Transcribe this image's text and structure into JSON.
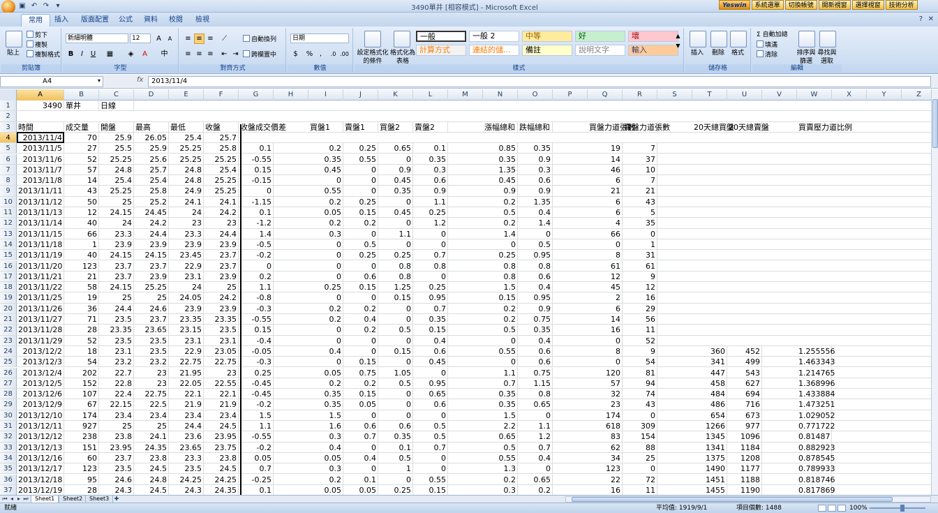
{
  "window": {
    "title": "3490單井 [相容模式] - Microsoft Excel",
    "addins": [
      "Yeswin",
      "系統選單",
      "切換帳號",
      "開新視窗",
      "選擇視窗",
      "技術分析"
    ]
  },
  "tabs": [
    "常用",
    "插入",
    "版面配置",
    "公式",
    "資料",
    "校閱",
    "檢視"
  ],
  "ribbon": {
    "clipboard": {
      "label": "剪貼簿",
      "paste": "貼上",
      "cut": "剪下",
      "copy": "複製",
      "format_painter": "複製格式"
    },
    "font": {
      "label": "字型",
      "font_name": "新細明體",
      "font_size": "12",
      "bold": "B",
      "italic": "I",
      "underline": "U"
    },
    "alignment": {
      "label": "對齊方式",
      "wrap": "自動換列",
      "merge": "跨欄置中"
    },
    "number": {
      "label": "數值",
      "format": "日期",
      "currency": "$",
      "percent": "%",
      "comma": ","
    },
    "styles": {
      "label": "樣式",
      "cond_format": "設定格式化的條件",
      "table_format": "格式化為表格",
      "items": [
        {
          "text": "一般",
          "bg": "#ffffff",
          "fg": "#000000"
        },
        {
          "text": "一般 2",
          "bg": "#ffffff",
          "fg": "#000000"
        },
        {
          "text": "中等",
          "bg": "#ffeb9c",
          "fg": "#9c6500"
        },
        {
          "text": "好",
          "bg": "#c6efce",
          "fg": "#006100"
        },
        {
          "text": "壞",
          "bg": "#ffc7ce",
          "fg": "#9c0006"
        },
        {
          "text": "計算方式",
          "bg": "#f2f2f2",
          "fg": "#fa7d00"
        },
        {
          "text": "連結的儲...",
          "bg": "#ffffff",
          "fg": "#fa7d00"
        },
        {
          "text": "備註",
          "bg": "#ffffcc",
          "fg": "#000000"
        },
        {
          "text": "說明文字",
          "bg": "#ffffff",
          "fg": "#7f7f7f"
        },
        {
          "text": "輸入",
          "bg": "#ffcc99",
          "fg": "#3f3f76"
        }
      ]
    },
    "cells": {
      "label": "儲存格",
      "insert": "插入",
      "delete": "刪除",
      "format": "格式"
    },
    "editing": {
      "label": "編輯",
      "autosum": "自動加總",
      "fill": "填滿",
      "clear": "清除",
      "sort": "排序與篩選",
      "find": "尋找與選取"
    }
  },
  "formula_bar": {
    "name_box": "A4",
    "fx": "fx",
    "content": "2013/11/4"
  },
  "columns": [
    "A",
    "B",
    "C",
    "D",
    "E",
    "F",
    "G",
    "H",
    "I",
    "J",
    "K",
    "L",
    "M",
    "N",
    "O",
    "P",
    "Q",
    "R",
    "S",
    "T",
    "U",
    "V",
    "W",
    "X",
    "Y",
    "Z"
  ],
  "cells": {
    "row1": {
      "num": "1",
      "A": "3490",
      "B": "單井",
      "C": "日線"
    },
    "row2": {
      "num": "2"
    },
    "row3": {
      "num": "3",
      "A": "時間",
      "B": "成交量",
      "C": "開盤",
      "D": "最高",
      "E": "最低",
      "F": "收盤",
      "G": "收盤成交價差",
      "I": "買盤1",
      "J": "賣盤1",
      "K": "買盤2",
      "L": "賣盤2",
      "N": "漲幅總和",
      "O": "跌幅總和",
      "Q": "買盤力道張數",
      "R": "賣盤力道張數",
      "T": "20天總買盤",
      "U": "20天總賣盤",
      "W": "買賣壓力道比例"
    },
    "data": [
      [
        "4",
        "2013/11/4",
        "70",
        "25.9",
        "26.05",
        "25.4",
        "25.7",
        "",
        "",
        "",
        "",
        "",
        "",
        "",
        "",
        "",
        "",
        "",
        "",
        "",
        ""
      ],
      [
        "5",
        "2013/11/5",
        "27",
        "25.5",
        "25.9",
        "25.25",
        "25.8",
        "0.1",
        "0.2",
        "0.25",
        "0.65",
        "0.1",
        "0.85",
        "0.35",
        "19",
        "7",
        "",
        "",
        ""
      ],
      [
        "6",
        "2013/11/6",
        "52",
        "25.25",
        "25.6",
        "25.25",
        "25.25",
        "-0.55",
        "0.35",
        "0.55",
        "0",
        "0.35",
        "0.35",
        "0.9",
        "14",
        "37",
        "",
        "",
        ""
      ],
      [
        "7",
        "2013/11/7",
        "57",
        "24.8",
        "25.7",
        "24.8",
        "25.4",
        "0.15",
        "0.45",
        "0",
        "0.9",
        "0.3",
        "1.35",
        "0.3",
        "46",
        "10",
        "",
        "",
        ""
      ],
      [
        "8",
        "2013/11/8",
        "14",
        "25.4",
        "25.4",
        "24.8",
        "25.25",
        "-0.15",
        "0",
        "0",
        "0.45",
        "0.6",
        "0.45",
        "0.6",
        "6",
        "7",
        "",
        "",
        ""
      ],
      [
        "9",
        "2013/11/11",
        "43",
        "25.25",
        "25.8",
        "24.9",
        "25.25",
        "0",
        "0.55",
        "0",
        "0.35",
        "0.9",
        "0.9",
        "0.9",
        "21",
        "21",
        "",
        "",
        ""
      ],
      [
        "10",
        "2013/11/12",
        "50",
        "25",
        "25.2",
        "24.1",
        "24.1",
        "-1.15",
        "0.2",
        "0.25",
        "0",
        "1.1",
        "0.2",
        "1.35",
        "6",
        "43",
        "",
        "",
        ""
      ],
      [
        "11",
        "2013/11/13",
        "12",
        "24.15",
        "24.45",
        "24",
        "24.2",
        "0.1",
        "0.05",
        "0.15",
        "0.45",
        "0.25",
        "0.5",
        "0.4",
        "6",
        "5",
        "",
        "",
        ""
      ],
      [
        "12",
        "2013/11/14",
        "40",
        "24",
        "24.2",
        "23",
        "23",
        "-1.2",
        "0.2",
        "0.2",
        "0",
        "1.2",
        "0.2",
        "1.4",
        "4",
        "35",
        "",
        "",
        ""
      ],
      [
        "13",
        "2013/11/15",
        "66",
        "23.3",
        "24.4",
        "23.3",
        "24.4",
        "1.4",
        "0.3",
        "0",
        "1.1",
        "0",
        "1.4",
        "0",
        "66",
        "0",
        "",
        "",
        ""
      ],
      [
        "14",
        "2013/11/18",
        "1",
        "23.9",
        "23.9",
        "23.9",
        "23.9",
        "-0.5",
        "0",
        "0.5",
        "0",
        "0",
        "0",
        "0.5",
        "0",
        "1",
        "",
        "",
        ""
      ],
      [
        "15",
        "2013/11/19",
        "40",
        "24.15",
        "24.15",
        "23.45",
        "23.7",
        "-0.2",
        "0",
        "0.25",
        "0.25",
        "0.7",
        "0.25",
        "0.95",
        "8",
        "31",
        "",
        "",
        ""
      ],
      [
        "16",
        "2013/11/20",
        "123",
        "23.7",
        "23.7",
        "22.9",
        "23.7",
        "0",
        "0",
        "0",
        "0.8",
        "0.8",
        "0.8",
        "0.8",
        "61",
        "61",
        "",
        "",
        ""
      ],
      [
        "17",
        "2013/11/21",
        "21",
        "23.7",
        "23.9",
        "23.1",
        "23.9",
        "0.2",
        "0",
        "0.6",
        "0.8",
        "0",
        "0.8",
        "0.6",
        "12",
        "9",
        "",
        "",
        ""
      ],
      [
        "18",
        "2013/11/22",
        "58",
        "24.15",
        "25.25",
        "24",
        "25",
        "1.1",
        "0.25",
        "0.15",
        "1.25",
        "0.25",
        "1.5",
        "0.4",
        "45",
        "12",
        "",
        "",
        ""
      ],
      [
        "19",
        "2013/11/25",
        "19",
        "25",
        "25",
        "24.05",
        "24.2",
        "-0.8",
        "0",
        "0",
        "0.15",
        "0.95",
        "0.15",
        "0.95",
        "2",
        "16",
        "",
        "",
        ""
      ],
      [
        "20",
        "2013/11/26",
        "36",
        "24.4",
        "24.6",
        "23.9",
        "23.9",
        "-0.3",
        "0.2",
        "0.2",
        "0",
        "0.7",
        "0.2",
        "0.9",
        "6",
        "29",
        "",
        "",
        ""
      ],
      [
        "21",
        "2013/11/27",
        "71",
        "23.5",
        "23.7",
        "23.35",
        "23.35",
        "-0.55",
        "0.2",
        "0.4",
        "0",
        "0.35",
        "0.2",
        "0.75",
        "14",
        "56",
        "",
        "",
        ""
      ],
      [
        "22",
        "2013/11/28",
        "28",
        "23.35",
        "23.65",
        "23.15",
        "23.5",
        "0.15",
        "0",
        "0.2",
        "0.5",
        "0.15",
        "0.5",
        "0.35",
        "16",
        "11",
        "",
        "",
        ""
      ],
      [
        "23",
        "2013/11/29",
        "52",
        "23.5",
        "23.5",
        "23.1",
        "23.1",
        "-0.4",
        "0",
        "0",
        "0",
        "0.4",
        "0",
        "0.4",
        "0",
        "52",
        "",
        "",
        ""
      ],
      [
        "24",
        "2013/12/2",
        "18",
        "23.1",
        "23.5",
        "22.9",
        "23.05",
        "-0.05",
        "0.4",
        "0",
        "0.15",
        "0.6",
        "0.55",
        "0.6",
        "8",
        "9",
        "360",
        "452",
        "1.255556"
      ],
      [
        "25",
        "2013/12/3",
        "54",
        "23.2",
        "23.2",
        "22.75",
        "22.75",
        "-0.3",
        "0",
        "0.15",
        "0",
        "0.45",
        "0",
        "0.6",
        "0",
        "54",
        "341",
        "499",
        "1.463343"
      ],
      [
        "26",
        "2013/12/4",
        "202",
        "22.7",
        "23",
        "21.95",
        "23",
        "0.25",
        "0.05",
        "0.75",
        "1.05",
        "0",
        "1.1",
        "0.75",
        "120",
        "81",
        "447",
        "543",
        "1.214765"
      ],
      [
        "27",
        "2013/12/5",
        "152",
        "22.8",
        "23",
        "22.05",
        "22.55",
        "-0.45",
        "0.2",
        "0.2",
        "0.5",
        "0.95",
        "0.7",
        "1.15",
        "57",
        "94",
        "458",
        "627",
        "1.368996"
      ],
      [
        "28",
        "2013/12/6",
        "107",
        "22.4",
        "22.75",
        "22.1",
        "22.1",
        "-0.45",
        "0.35",
        "0.15",
        "0",
        "0.65",
        "0.35",
        "0.8",
        "32",
        "74",
        "484",
        "694",
        "1.433884"
      ],
      [
        "29",
        "2013/12/9",
        "67",
        "22.15",
        "22.5",
        "21.9",
        "21.9",
        "-0.2",
        "0.35",
        "0.05",
        "0",
        "0.6",
        "0.35",
        "0.65",
        "23",
        "43",
        "486",
        "716",
        "1.473251"
      ],
      [
        "30",
        "2013/12/10",
        "174",
        "23.4",
        "23.4",
        "23.4",
        "23.4",
        "1.5",
        "1.5",
        "0",
        "0",
        "0",
        "1.5",
        "0",
        "174",
        "0",
        "654",
        "673",
        "1.029052"
      ],
      [
        "31",
        "2013/12/11",
        "927",
        "25",
        "25",
        "24.4",
        "24.5",
        "1.1",
        "1.6",
        "0.6",
        "0.6",
        "0.5",
        "2.2",
        "1.1",
        "618",
        "309",
        "1266",
        "977",
        "0.771722"
      ],
      [
        "32",
        "2013/12/12",
        "238",
        "23.8",
        "24.1",
        "23.6",
        "23.95",
        "-0.55",
        "0.3",
        "0.7",
        "0.35",
        "0.5",
        "0.65",
        "1.2",
        "83",
        "154",
        "1345",
        "1096",
        "0.81487"
      ],
      [
        "33",
        "2013/12/13",
        "151",
        "23.95",
        "24.35",
        "23.65",
        "23.75",
        "-0.2",
        "0.4",
        "0",
        "0.1",
        "0.7",
        "0.5",
        "0.7",
        "62",
        "88",
        "1341",
        "1184",
        "0.882923"
      ],
      [
        "34",
        "2013/12/16",
        "60",
        "23.7",
        "23.8",
        "23.3",
        "23.8",
        "0.05",
        "0.05",
        "0.4",
        "0.5",
        "0",
        "0.55",
        "0.4",
        "34",
        "25",
        "1375",
        "1208",
        "0.878545"
      ],
      [
        "35",
        "2013/12/17",
        "123",
        "23.5",
        "24.5",
        "23.5",
        "24.5",
        "0.7",
        "0.3",
        "0",
        "1",
        "0",
        "1.3",
        "0",
        "123",
        "0",
        "1490",
        "1177",
        "0.789933"
      ],
      [
        "36",
        "2013/12/18",
        "95",
        "24.6",
        "24.8",
        "24.25",
        "24.25",
        "-0.25",
        "0.2",
        "0.1",
        "0",
        "0.55",
        "0.2",
        "0.65",
        "22",
        "72",
        "1451",
        "1188",
        "0.818746"
      ],
      [
        "37",
        "2013/12/19",
        "28",
        "24.3",
        "24.5",
        "24.3",
        "24.35",
        "0.1",
        "0.05",
        "0.05",
        "0.25",
        "0.15",
        "0.3",
        "0.2",
        "16",
        "11",
        "1455",
        "1190",
        "0.817869"
      ]
    ]
  },
  "sheets": [
    "Sheet1",
    "Sheet2",
    "Sheet3"
  ],
  "status": {
    "ready": "就緒",
    "average": "平均值: 1919/9/1",
    "count": "項目個數: 1488",
    "zoom": "100%"
  }
}
